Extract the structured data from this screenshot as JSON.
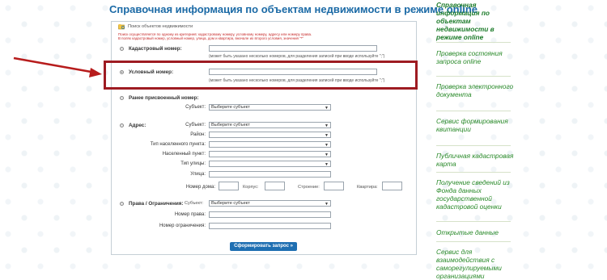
{
  "page": {
    "title": "Справочная информация по объектам недвижимости в режиме online"
  },
  "sidebar": {
    "items": [
      {
        "label": "Справочная информация по объектам недвижимости в режиме online",
        "selected": true
      },
      {
        "label": "Проверка состояния запроса online"
      },
      {
        "label": "Проверка электронного документа"
      },
      {
        "label": "Сервис формирования квитанции"
      },
      {
        "label": "Публичная кадастровая карта"
      },
      {
        "label": "Получение сведений из Фонда данных государственной кадастровой оценки"
      },
      {
        "label": "Открытые данные"
      },
      {
        "label": "Сервис для взаимодействия с саморегулируемыми организациями"
      }
    ]
  },
  "form": {
    "header": "Поиск объектов недвижимости",
    "notes": [
      "Поиск осуществляется по одному из критериев: кадастровому номеру, условному номеру, адресу или номеру права.",
      "В полях кадастровый номер, условный номер, улица, дом и квартира, вначале их второго условия, значения \"*\""
    ],
    "multi_hint": "(может быть указано несколько номеров, для разделения записей при вводе используйте \";\")",
    "cadastral": {
      "label": "Кадастровый номер:",
      "value": ""
    },
    "conditional": {
      "label": "Условный номер:",
      "value": ""
    },
    "prev": {
      "label": "Ранее присвоенный номер:",
      "subject_label": "Субъект:",
      "subject_value": "Выберите субъект"
    },
    "address": {
      "label": "Адрес:",
      "subject_label": "Субъект:",
      "subject_value": "Выберите субъект",
      "district_label": "Район:",
      "settlement_type_label": "Тип населенного пункта:",
      "settlement_label": "Населенный пункт:",
      "street_type_label": "Тип улицы:",
      "street_label": "Улица:",
      "house_label": "Номер дома:",
      "building_label": "Корпус:",
      "structure_label": "Строение:",
      "apartment_label": "Квартира:"
    },
    "rights": {
      "label": "Права / Ограничения:",
      "subject_label": "Субъект:",
      "subject_value": "Выберите субъект",
      "right_label": "Номер права:",
      "restriction_label": "Номер ограничения:"
    },
    "submit_label": "Сформировать запрос »"
  },
  "colors": {
    "accent": "#1b6aa6",
    "sidebar_text": "#2a8a2a",
    "highlight": "#9e1b22",
    "button": "#1f6fb2",
    "arrow": "#b71c1c"
  }
}
